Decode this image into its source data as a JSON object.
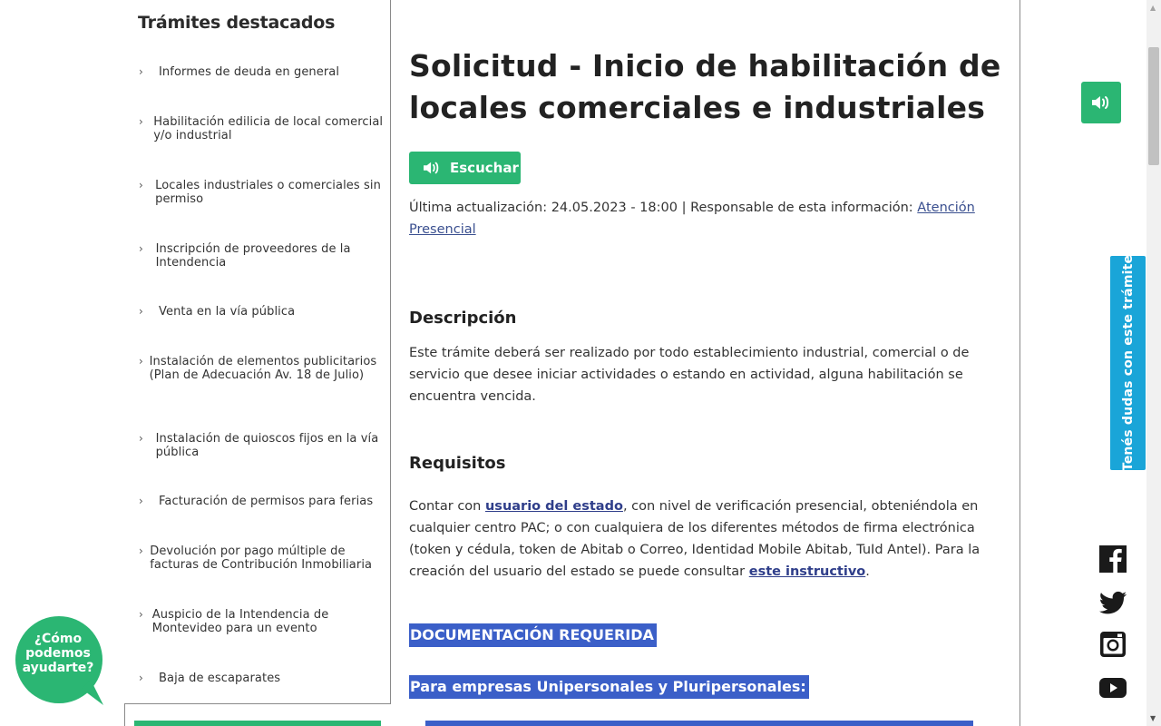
{
  "sidebar": {
    "title": "Trámites destacados",
    "items": [
      {
        "label": "Informes de deuda en general"
      },
      {
        "label": "Habilitación edilicia de local comercial y/o industrial"
      },
      {
        "label": "Locales industriales o comerciales sin permiso"
      },
      {
        "label": "Inscripción de proveedores de la Intendencia"
      },
      {
        "label": "Venta en la vía pública"
      },
      {
        "label": "Instalación de elementos publicitarios (Plan de Adecuación Av. 18 de Julio)"
      },
      {
        "label": "Instalación de quioscos fijos en la vía pública"
      },
      {
        "label": "Facturación de permisos para ferias"
      },
      {
        "label": "Devolución por pago múltiple de facturas de Contribución Inmobiliaria"
      },
      {
        "label": "Auspicio de la Intendencia de Montevideo para un evento"
      },
      {
        "label": "Baja de escaparates"
      }
    ]
  },
  "main": {
    "title": "Solicitud - Inicio de habilitación de locales comerciales e industriales",
    "listen_label": "Escuchar",
    "meta_prefix": "Última actualización: 24.05.2023 - 18:00 | Responsable de esta información: ",
    "meta_link": "Atención Presencial",
    "description_heading": "Descripción",
    "description_text": "Este trámite deberá ser realizado por todo establecimiento industrial, comercial o de servicio que desee iniciar actividades o estando en actividad, alguna habilitación se encuentra vencida.",
    "requirements_heading": "Requisitos",
    "req_part1": "Contar con ",
    "req_link1": "usuario del estado",
    "req_part2": ", con nivel de verificación presencial, obteniéndola en cualquier centro PAC; o con cualquiera de los diferentes métodos de firma electrónica (token y cédula, token de Abitab o Correo, Identidad Mobile Abitab, TuId Antel). Para la creación del usuario del estado se puede consultar ",
    "req_link2": "este instructivo",
    "req_part3": ".",
    "doc_heading": "DOCUMENTACIÓN REQUERIDA",
    "doc_subheading": "Para empresas Unipersonales y Pluripersonales:"
  },
  "widgets": {
    "doubts_tab": "¿Tenés dudas con este trámite?",
    "help_bubble": "¿Cómo podemos ayudarte?"
  },
  "colors": {
    "green": "#2bb673",
    "blue_tab": "#1aa5d8",
    "highlight": "#3b5fc8",
    "link": "#2f3e8a"
  },
  "social": [
    "facebook-icon",
    "twitter-icon",
    "instagram-icon",
    "youtube-icon"
  ]
}
